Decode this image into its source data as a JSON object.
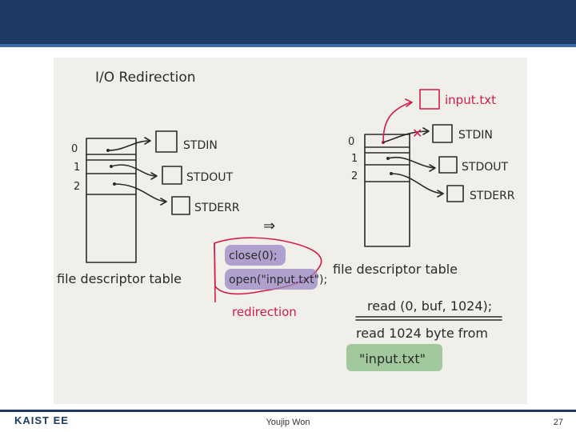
{
  "slide": {
    "title": "I/O Redirection",
    "left_table": {
      "indices": [
        "0",
        "1",
        "2"
      ],
      "targets": [
        "STDIN",
        "STDOUT",
        "STDERR"
      ],
      "caption": "file descriptor table"
    },
    "arrow_glyph": "⇒",
    "code_block": {
      "line1": "close(0);",
      "line2": "open(\"input.txt\");",
      "caption": "redirection"
    },
    "right_table": {
      "indices": [
        "0",
        "1",
        "2"
      ],
      "targets": [
        "STDIN",
        "STDOUT",
        "STDERR"
      ],
      "new_target": "input.txt",
      "cross": "✕",
      "caption": "file descriptor table"
    },
    "read_call": "read (0, buf, 1024);",
    "read_desc": "read 1024 byte from",
    "read_source": "\"input.txt\""
  },
  "footer": {
    "logo": "KAIST EE",
    "author": "Youjip Won",
    "page": "27"
  },
  "colors": {
    "header": "#1c3a63",
    "accent_red": "#d11b4d",
    "highlight_purple": "#9a86c4",
    "highlight_green": "#8fbf8a"
  }
}
